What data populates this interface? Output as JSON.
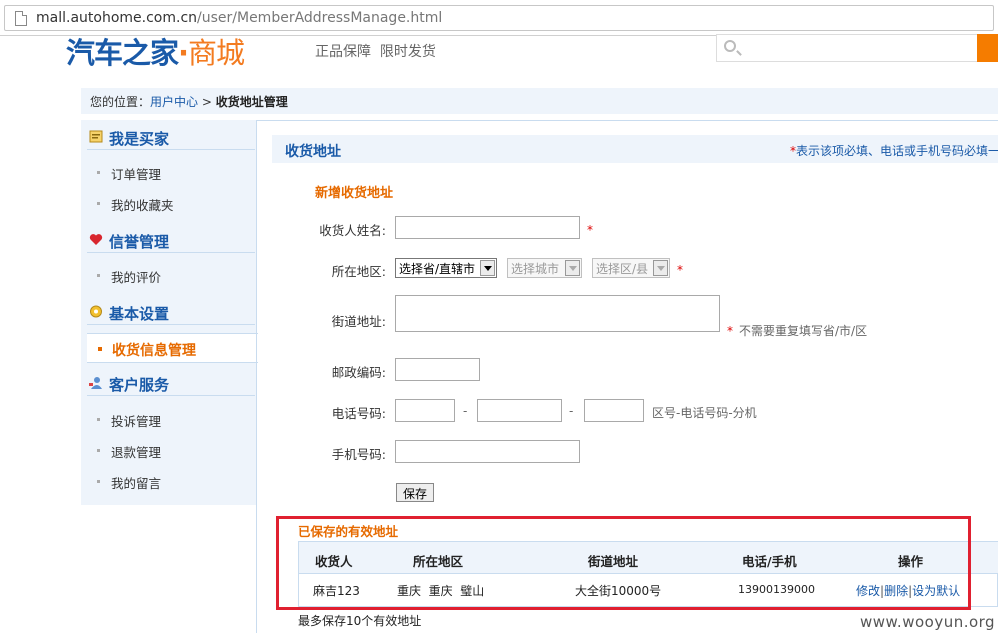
{
  "browser": {
    "url_host": "mall.autohome.com.cn",
    "url_path": "/user/MemberAddressManage.html"
  },
  "header": {
    "logo_main": "汽车之家",
    "logo_dot": "·",
    "logo_mall": "商城",
    "slogan": "正品保障  限时发货"
  },
  "breadcrumb": {
    "prefix": "您的位置：",
    "link": "用户中心",
    "separator": ">",
    "current": "收货地址管理"
  },
  "sidebar": {
    "buyer": {
      "title": "我是买家",
      "items": [
        "订单管理",
        "我的收藏夹"
      ]
    },
    "credit": {
      "title": "信誉管理",
      "items": [
        "我的评价"
      ]
    },
    "settings": {
      "title": "基本设置",
      "active": "收货信息管理"
    },
    "service": {
      "title": "客户服务",
      "items": [
        "投诉管理",
        "退款管理",
        "我的留言"
      ]
    }
  },
  "main": {
    "title": "收货地址",
    "note_star": "*",
    "note": "表示该项必填、电话或手机号码必填一",
    "new_title": "新增收货地址",
    "form": {
      "name_label": "收货人姓名:",
      "region_label": "所在地区:",
      "province": "选择省/直辖市",
      "city": "选择城市",
      "district": "选择区/县",
      "street_label": "街道地址:",
      "street_hint": "不需要重复填写省/市/区",
      "zip_label": "邮政编码:",
      "phone_label": "电话号码:",
      "phone_hint": "区号-电话号码-分机",
      "mobile_label": "手机号码:",
      "required": "*",
      "dash": "-",
      "save": "保存"
    },
    "saved": {
      "title": "已保存的有效地址",
      "headers": [
        "收货人",
        "所在地区",
        "街道地址",
        "电话/手机",
        "操作"
      ],
      "row": {
        "name": "麻吉123",
        "region": "重庆  重庆  璧山",
        "street": "大全街10000号",
        "phone": "13900139000",
        "edit": "修改",
        "delete": "删除",
        "set_default": "设为默认",
        "sep": "|"
      },
      "max_note": "最多保存10个有效地址"
    }
  },
  "watermark": "www.wooyun.org",
  "colors": {
    "brand_blue": "#1a5aa8",
    "accent_orange": "#e66a00",
    "highlight_red": "#e02030"
  }
}
